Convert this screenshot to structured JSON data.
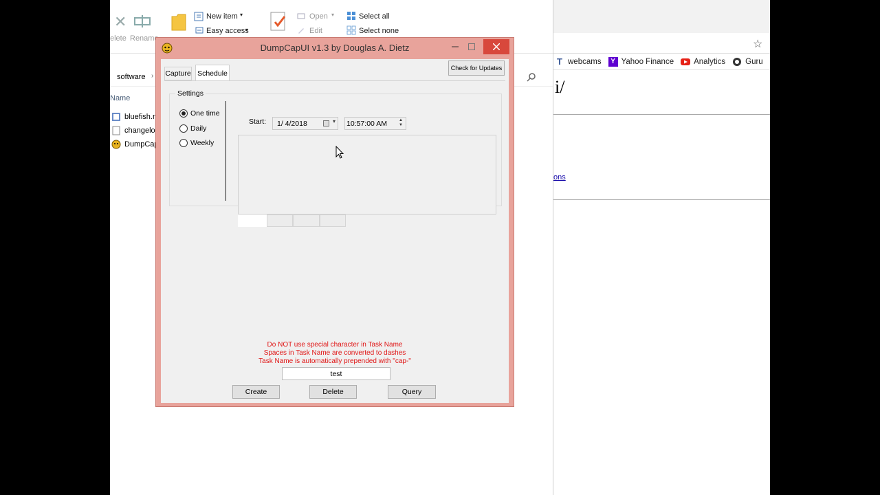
{
  "explorer": {
    "ribbon": {
      "delete": "elete",
      "rename": "Rename",
      "new_item": "New item",
      "easy_access": "Easy access",
      "open": "Open",
      "edit": "Edit",
      "select_all": "Select all",
      "select_none": "Select none"
    },
    "breadcrumb": "software",
    "column_name": "Name",
    "files": [
      {
        "name": "bluefish.n"
      },
      {
        "name": "changelo"
      },
      {
        "name": "DumpCap"
      }
    ]
  },
  "browser": {
    "bookmarks": [
      {
        "label": "webcams",
        "icon": "T"
      },
      {
        "label": "Yahoo Finance",
        "icon": "Y"
      },
      {
        "label": "Analytics",
        "icon": "youtube-icon"
      },
      {
        "label": "Guru",
        "icon": "gear-icon"
      }
    ],
    "heading": "i/",
    "link": "ons"
  },
  "dialog": {
    "title": "DumpCapUI  v1.3   by Douglas A. Dietz",
    "tabs": [
      "Capture",
      "Schedule"
    ],
    "active_tab": "Schedule",
    "check_updates": "Check for Updates",
    "settings": {
      "label": "Settings",
      "options": [
        {
          "label": "One time",
          "selected": true
        },
        {
          "label": "Daily",
          "selected": false
        },
        {
          "label": "Weekly",
          "selected": false
        }
      ]
    },
    "start_label": "Start:",
    "start_date": "1/  4/2018",
    "start_time": "10:57:00 AM",
    "warning": [
      "Do NOT use special character in Task Name",
      "Spaces in Task Name are converted to dashes",
      "Task Name is automatically prepended with \"cap-\""
    ],
    "task_name": "test",
    "buttons": {
      "create": "Create",
      "delete": "Delete",
      "query": "Query"
    }
  },
  "colors": {
    "title_frame": "#e8a39b",
    "close": "#d8483c",
    "warning_text": "#e01414"
  }
}
